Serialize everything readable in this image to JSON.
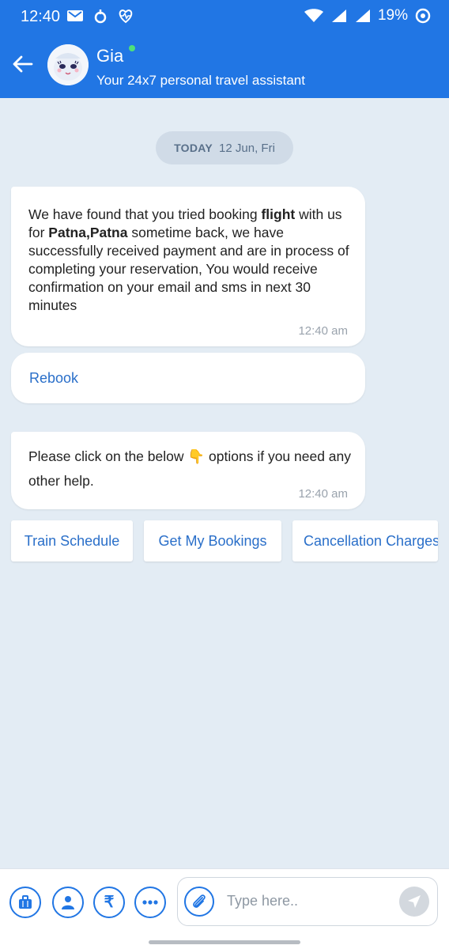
{
  "status_bar": {
    "time": "12:40",
    "battery": "19%"
  },
  "header": {
    "title": "Gia",
    "subtitle": "Your 24x7 personal travel assistant",
    "back_icon": "arrow-left-icon",
    "avatar": "bot-avatar"
  },
  "chat": {
    "date_label": "TODAY",
    "date_value": "12 Jun, Fri",
    "message1": {
      "parts": [
        "We have found that you tried booking ",
        "flight",
        " with us for ",
        "Patna,Patna",
        " sometime back, we have successfully received payment and are in process of completing your reservation, You would receive confirmation on your email and sms in next 30 minutes"
      ],
      "time": "12:40 am"
    },
    "rebook_label": "Rebook",
    "message2": {
      "before": "Please click on the below ",
      "emoji": "👇",
      "after": " options if you need any other help.",
      "time": "12:40 am"
    },
    "quick_replies": [
      "Train Schedule",
      "Get My Bookings",
      "Cancellation Charges"
    ]
  },
  "composer": {
    "placeholder": "Type here..",
    "icons": [
      "briefcase-icon",
      "person-icon",
      "rupee-icon",
      "more-icon",
      "attach-icon",
      "send-icon"
    ],
    "rupee_symbol": "₹"
  },
  "colors": {
    "brand": "#2176e4",
    "link": "#2a6fc9",
    "background": "#e3ecf4"
  }
}
